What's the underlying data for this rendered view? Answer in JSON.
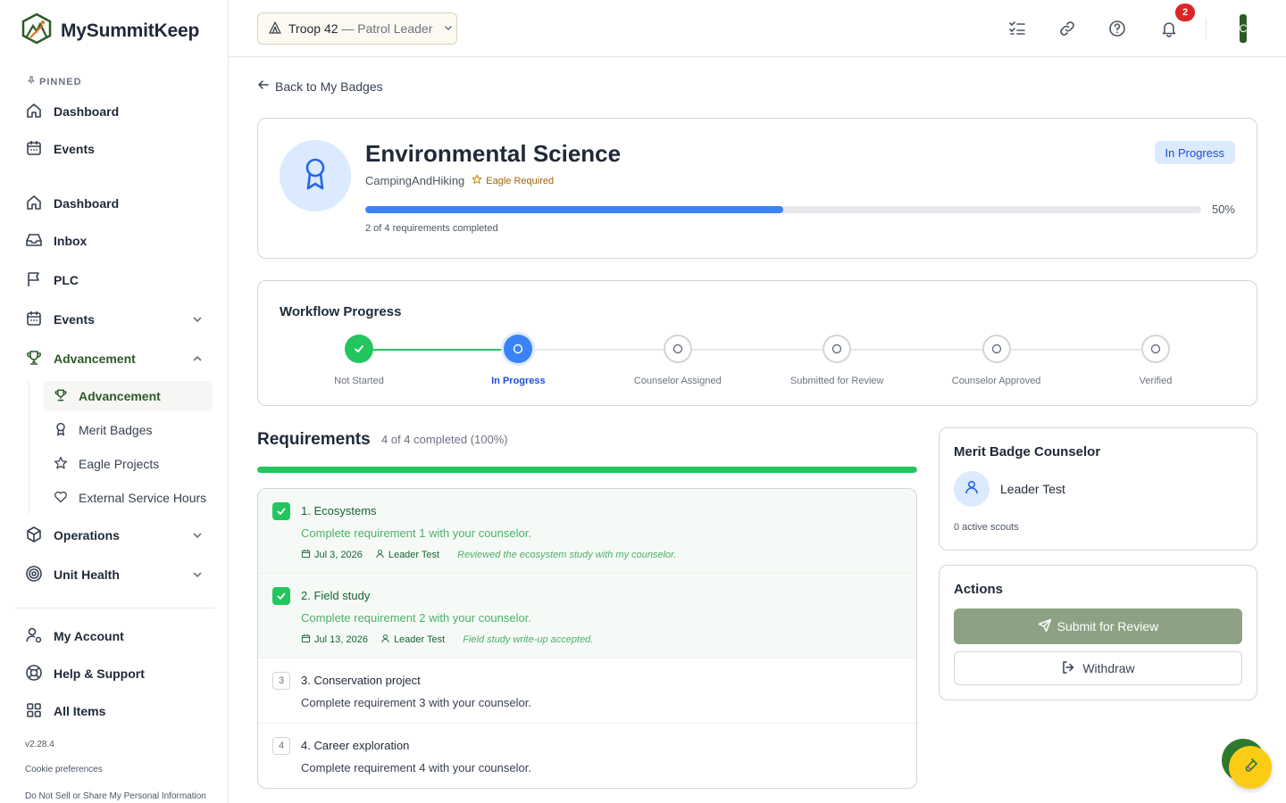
{
  "app": {
    "name": "MySummitKeep",
    "version": "v2.28.4"
  },
  "sidebar": {
    "pinned_label": "PINNED",
    "pinned": [
      {
        "label": "Dashboard",
        "icon": "home-icon"
      },
      {
        "label": "Events",
        "icon": "calendar-icon"
      }
    ],
    "items": [
      {
        "label": "Dashboard",
        "icon": "home-icon"
      },
      {
        "label": "Inbox",
        "icon": "inbox-icon"
      },
      {
        "label": "PLC",
        "icon": "flag-icon"
      },
      {
        "label": "Events",
        "icon": "calendar-icon",
        "expandable": true
      },
      {
        "label": "Advancement",
        "icon": "trophy-icon",
        "expanded": true,
        "active": true
      },
      {
        "label": "Operations",
        "icon": "box-icon",
        "expandable": true
      },
      {
        "label": "Unit Health",
        "icon": "target-icon",
        "expandable": true
      }
    ],
    "advancement_sub": [
      {
        "label": "Advancement",
        "icon": "trophy-icon",
        "active": true
      },
      {
        "label": "Merit Badges",
        "icon": "award-icon"
      },
      {
        "label": "Eagle Projects",
        "icon": "star-icon"
      },
      {
        "label": "External Service Hours",
        "icon": "heart-icon"
      }
    ],
    "bottom": [
      {
        "label": "My Account",
        "icon": "user-cog-icon"
      },
      {
        "label": "Help & Support",
        "icon": "lifebuoy-icon"
      },
      {
        "label": "All Items",
        "icon": "grid-icon"
      }
    ],
    "cookie": "Cookie preferences",
    "privacy": "Do Not Sell or Share My Personal Information"
  },
  "header": {
    "troop": "Troop 42",
    "role": "— Patrol Leader",
    "notifications": "2",
    "avatar_initial": "C"
  },
  "back_link": "Back to My Badges",
  "badge": {
    "title": "Environmental Science",
    "category": "CampingAndHiking",
    "eagle_label": "Eagle Required",
    "status": "In Progress",
    "progress_pct": 50,
    "progress_label": "50%",
    "progress_text": "2 of 4 requirements completed"
  },
  "workflow": {
    "title": "Workflow Progress",
    "steps": [
      {
        "label": "Not Started",
        "state": "done"
      },
      {
        "label": "In Progress",
        "state": "current"
      },
      {
        "label": "Counselor Assigned",
        "state": "pending"
      },
      {
        "label": "Submitted for Review",
        "state": "pending"
      },
      {
        "label": "Counselor Approved",
        "state": "pending"
      },
      {
        "label": "Verified",
        "state": "pending"
      }
    ]
  },
  "requirements": {
    "title": "Requirements",
    "summary": "4 of 4 completed (100%)",
    "bar_pct": 100,
    "items": [
      {
        "num": "1",
        "name": "1. Ecosystems",
        "desc": "Complete requirement 1 with your counselor.",
        "done": true,
        "date": "Jul 3, 2026",
        "by": "Leader Test",
        "note": "Reviewed the ecosystem study with my counselor."
      },
      {
        "num": "2",
        "name": "2. Field study",
        "desc": "Complete requirement 2 with your counselor.",
        "done": true,
        "date": "Jul 13, 2026",
        "by": "Leader Test",
        "note": "Field study write-up accepted."
      },
      {
        "num": "3",
        "name": "3. Conservation project",
        "desc": "Complete requirement 3 with your counselor.",
        "done": false
      },
      {
        "num": "4",
        "name": "4. Career exploration",
        "desc": "Complete requirement 4 with your counselor.",
        "done": false
      }
    ]
  },
  "counselor": {
    "title": "Merit Badge Counselor",
    "name": "Leader Test",
    "sub": "0 active scouts"
  },
  "actions": {
    "title": "Actions",
    "submit": "Submit for Review",
    "withdraw": "Withdraw"
  },
  "colors": {
    "brand": "#2d5a27",
    "accent_blue": "#3b82f6",
    "success": "#22c55e",
    "fab": "#facc15"
  }
}
